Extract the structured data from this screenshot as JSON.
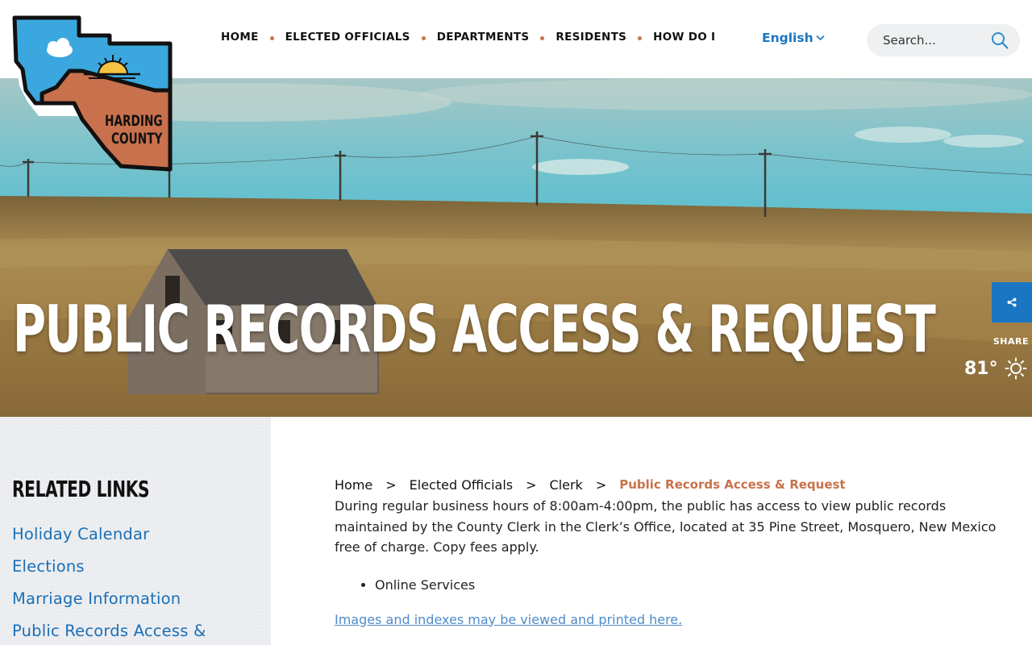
{
  "header": {
    "nav": [
      {
        "label": "HOME"
      },
      {
        "label": "ELECTED OFFICIALS"
      },
      {
        "label": "DEPARTMENTS"
      },
      {
        "label": "RESIDENTS"
      },
      {
        "label": "HOW DO I"
      }
    ],
    "language": "English",
    "search_placeholder": "Search..."
  },
  "logo": {
    "line1": "HARDING",
    "line2": "COUNTY"
  },
  "hero": {
    "title": "PUBLIC RECORDS ACCESS & REQUEST",
    "share_label": "SHARE",
    "temperature": "81°"
  },
  "sidebar": {
    "title": "RELATED LINKS",
    "links": [
      {
        "label": "Holiday Calendar"
      },
      {
        "label": "Elections"
      },
      {
        "label": "Marriage Information"
      },
      {
        "label": "Public Records Access &"
      }
    ]
  },
  "content": {
    "breadcrumb": [
      "Home",
      "Elected Officials",
      "Clerk"
    ],
    "breadcrumb_current": "Public Records Access & Request",
    "breadcrumb_separator": ">",
    "paragraph": "During regular business hours of 8:00am-4:00pm, the public has access to view public records maintained by the County Clerk in the Clerk’s Office, located at 35 Pine Street, Mosquero, New Mexico free of charge. Copy fees apply.",
    "services": [
      "Online Services"
    ],
    "records_link": "Images and indexes may be viewed and printed here."
  },
  "colors": {
    "accent_blue": "#1a76c2",
    "accent_orange": "#c8714c",
    "logo_blue": "#3aa8de",
    "logo_rust": "#c8714c"
  }
}
